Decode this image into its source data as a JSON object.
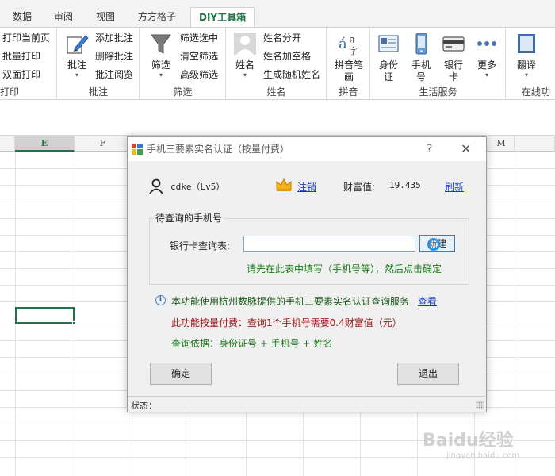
{
  "ribbon_tabs": [
    {
      "label": "数据"
    },
    {
      "label": "审阅"
    },
    {
      "label": "视图"
    },
    {
      "label": "方方格子"
    },
    {
      "label": "DIY工具箱",
      "active": true
    }
  ],
  "ribbon": {
    "print": {
      "items": [
        "打印当前页",
        "批量打印",
        "双面打印"
      ],
      "label": "打印"
    },
    "comment": {
      "big": "批注",
      "items": [
        "添加批注",
        "删除批注",
        "批注阅览"
      ],
      "label": "批注"
    },
    "filter": {
      "big": "筛选",
      "items": [
        "筛选选中",
        "清空筛选",
        "高级筛选"
      ],
      "label": "筛选"
    },
    "name": {
      "big": "姓名",
      "items": [
        "姓名分开",
        "姓名加空格",
        "生成随机姓名"
      ],
      "label": "姓名"
    },
    "pinyin": {
      "big_line1": "拼音笔",
      "big_line2": "画",
      "label": "拼音"
    },
    "life": {
      "items": [
        {
          "l1": "身份",
          "l2": "证"
        },
        {
          "l1": "手机",
          "l2": "号"
        },
        {
          "l1": "银行",
          "l2": "卡"
        },
        {
          "l1": "更多",
          "l2": ""
        }
      ],
      "label": "生活服务"
    },
    "online": {
      "big": "翻译",
      "label": "在线功"
    }
  },
  "sheet": {
    "columns": [
      {
        "label": "E",
        "selected": true
      },
      {
        "label": "F"
      },
      {
        "label": "M"
      }
    ]
  },
  "dialog": {
    "title": "手机三要素实名认证（按量付费）",
    "help": "?",
    "close": "✕",
    "user": "cdke（Lv5）",
    "logout": "注销",
    "wealth_label": "财富值:",
    "wealth_value": "19.435",
    "refresh": "刷新",
    "group_title": "待查询的手机号",
    "bank_label": "银行卡查询表:",
    "bank_value": "",
    "new_button": "新建",
    "hint": "请先在此表中填写（手机号等），然后点击确定",
    "info": "本功能使用杭州数脉提供的手机三要素实名认证查询服务",
    "view_link": "查看",
    "fee": "此功能按量付费：查询1个手机号需要0.4财富值（元）",
    "basis": "查询依据：身份证号 + 手机号 + 姓名",
    "ok": "确定",
    "exit": "退出",
    "status_label": "状态："
  },
  "watermark": {
    "main": "Baidu经验",
    "sub": "jingyan.baidu.com"
  },
  "colors": {
    "excel_green": "#217346",
    "link_blue": "#1a3cc2",
    "fee_red": "#a01616",
    "hint_green": "#1a7a1a"
  }
}
